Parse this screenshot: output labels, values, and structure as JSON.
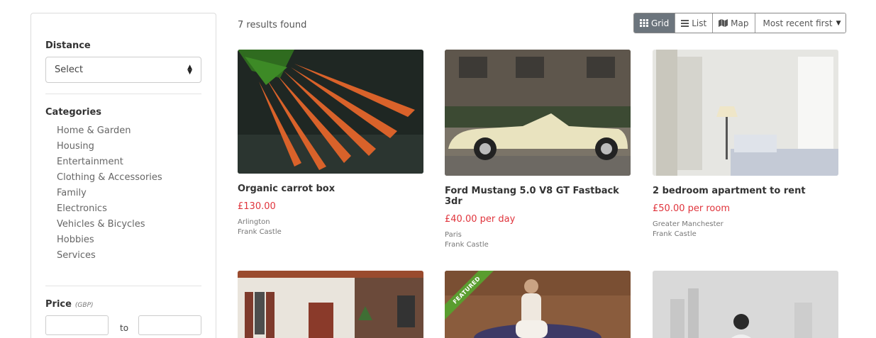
{
  "filters": {
    "distance_title": "Distance",
    "distance_select": "Select",
    "categories_title": "Categories",
    "categories": [
      "Home & Garden",
      "Housing",
      "Entertainment",
      "Clothing & Accessories",
      "Family",
      "Electronics",
      "Vehicles & Bicycles",
      "Hobbies",
      "Services"
    ],
    "price_title": "Price",
    "price_unit": "(GBP)",
    "price_to_label": "to"
  },
  "results": {
    "count_text": "7 results found",
    "views": {
      "grid": "Grid",
      "list": "List",
      "map": "Map"
    },
    "active_view": "grid",
    "sort": "Most recent first"
  },
  "listings": [
    {
      "title": "Organic carrot box",
      "price": "£130.00",
      "location": "Arlington",
      "seller": "Frank Castle",
      "image": "carrots"
    },
    {
      "title": "Ford Mustang 5.0 V8 GT Fastback 3dr",
      "price": "£40.00 per day",
      "location": "Paris",
      "seller": "Frank Castle",
      "image": "car"
    },
    {
      "title": "2 bedroom apartment to rent",
      "price": "£50.00 per room",
      "location": "Greater Manchester",
      "seller": "Frank Castle",
      "image": "bedroom"
    },
    {
      "image": "house"
    },
    {
      "image": "yoga",
      "featured": "FEATURED"
    },
    {
      "image": "person"
    }
  ],
  "colors": {
    "price": "#e0343c",
    "featured_ribbon": "#5a9d2f",
    "active_view": "#6c757d"
  }
}
